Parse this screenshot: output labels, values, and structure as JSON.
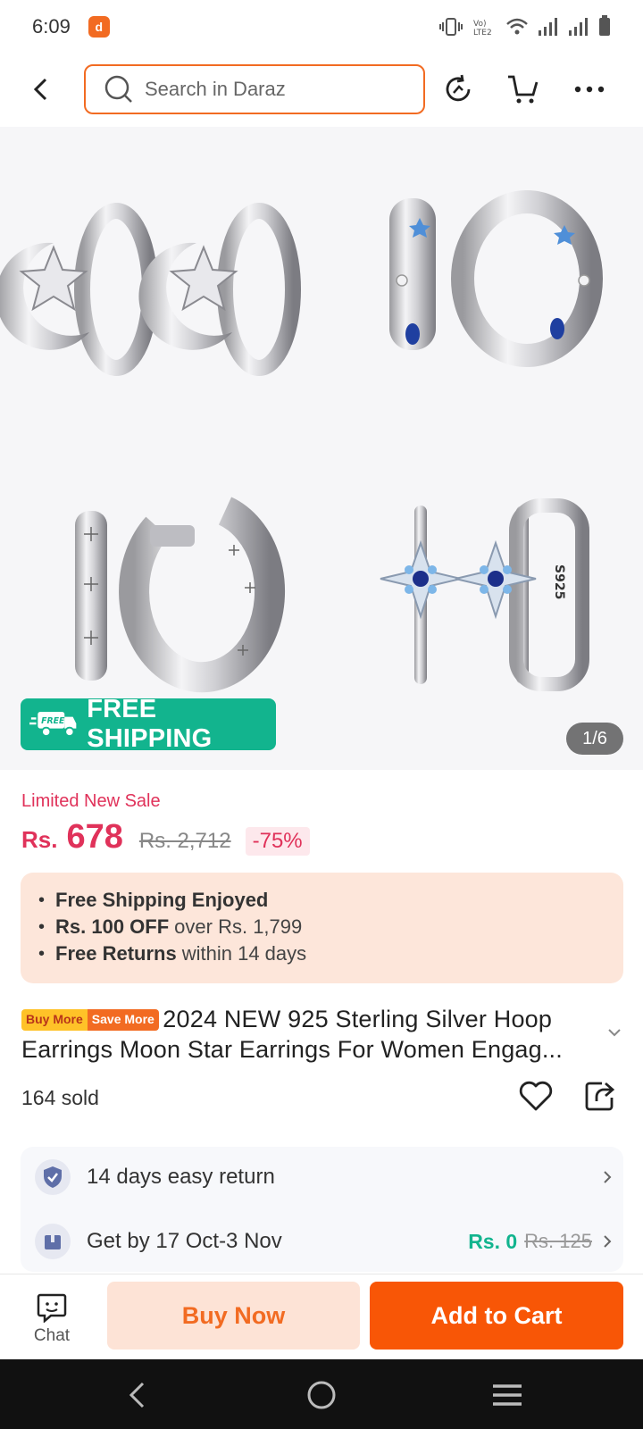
{
  "status_bar": {
    "time": "6:09",
    "network_label": "LTE2"
  },
  "search": {
    "placeholder": "Search in Daraz"
  },
  "gallery": {
    "free_shipping_tag": "FREE",
    "free_shipping_label": "FREE SHIPPING",
    "page_counter": "1/6",
    "hoop_engraving": "S925"
  },
  "price": {
    "sale_label": "Limited New Sale",
    "currency": "Rs.",
    "current": "678",
    "original": "Rs. 2,712",
    "discount": "-75%"
  },
  "promos": [
    {
      "bold": "Free Shipping Enjoyed",
      "text": ""
    },
    {
      "bold": "Rs. 100 OFF",
      "text": "over Rs. 1,799"
    },
    {
      "bold": "Free Returns",
      "text": "within 14 days"
    }
  ],
  "product": {
    "badge_left": "Buy More",
    "badge_right": "Save More",
    "title": "2024 NEW 925 Sterling Silver Hoop Earrings Moon Star Earrings For Women Engag...",
    "sold": "164 sold"
  },
  "services": {
    "returns": "14 days easy return",
    "delivery": "Get by 17 Oct-3 Nov",
    "delivery_price": "Rs. 0",
    "delivery_original": "Rs. 125"
  },
  "bottom": {
    "chat": "Chat",
    "buy_now": "Buy Now",
    "add_to_cart": "Add to Cart"
  },
  "colors": {
    "accent": "#f85606",
    "price": "#e0325a",
    "free_ship": "#12b48e"
  }
}
